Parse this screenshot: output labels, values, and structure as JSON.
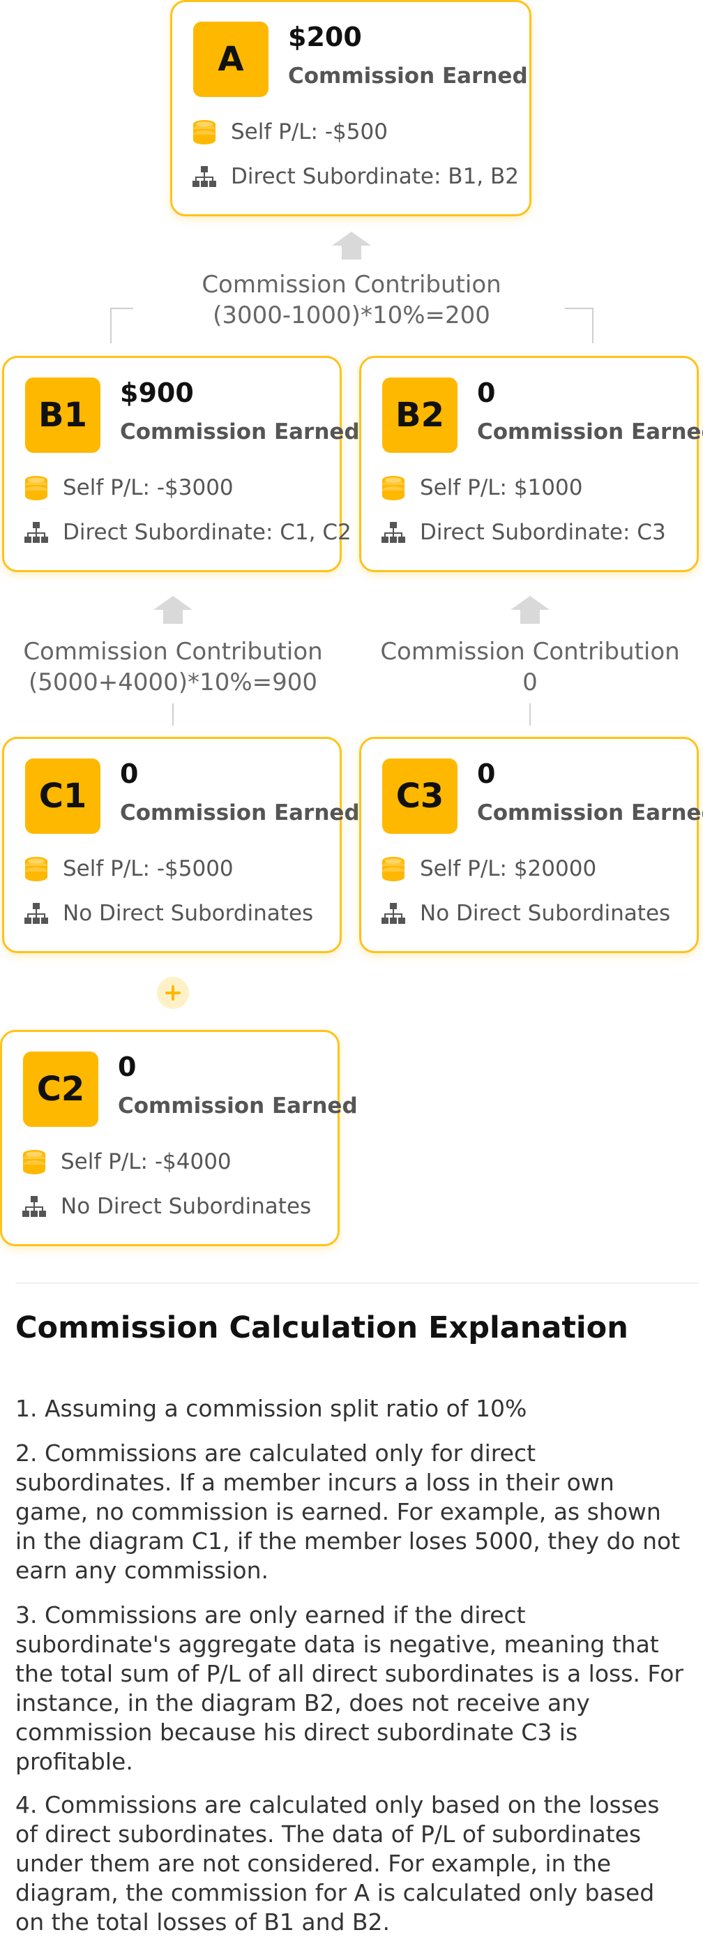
{
  "nodes": {
    "A": {
      "label": "A",
      "amount": "$200",
      "earned": "Commission Earned",
      "pl": "Self P/L: -$500",
      "subs": "Direct  Subordinate: B1, B2"
    },
    "B1": {
      "label": "B1",
      "amount": "$900",
      "earned": "Commission Earned",
      "pl": "Self P/L: -$3000",
      "subs": "Direct  Subordinate: C1, C2"
    },
    "B2": {
      "label": "B2",
      "amount": "0",
      "earned": "Commission Earned",
      "pl": "Self P/L: $1000",
      "subs": "Direct  Subordinate: C3"
    },
    "C1": {
      "label": "C1",
      "amount": "0",
      "earned": "Commission Earned",
      "pl": "Self P/L: -$5000",
      "subs": "No Direct Subordinates"
    },
    "C3": {
      "label": "C3",
      "amount": "0",
      "earned": "Commission Earned",
      "pl": "Self P/L: $20000",
      "subs": "No Direct Subordinates"
    },
    "C2": {
      "label": "C2",
      "amount": "0",
      "earned": "Commission Earned",
      "pl": "Self P/L: -$4000",
      "subs": "No Direct Subordinates"
    }
  },
  "contributions": {
    "to_A": {
      "title": "Commission   Contribution",
      "formula": "(3000-1000)*10%=200"
    },
    "to_B1": {
      "title": "Commission   Contribution",
      "formula": "(5000+4000)*10%=900"
    },
    "to_B2": {
      "title": "Commission   Contribution",
      "formula": "0"
    }
  },
  "explanation": {
    "title": "Commission Calculation Explanation",
    "points": [
      "1. Assuming a commission split ratio of 10%",
      "2. Commissions are calculated only for direct subordinates. If a member incurs a loss in their own game, no commission is earned. For example, as shown in the diagram C1, if the member loses 5000, they do not earn any commission.",
      "3. Commissions are only earned if the direct subordinate's aggregate data is negative, meaning that the total sum of P/L of all direct subordinates is a loss. For instance, in the diagram B2, does not receive any commission because his direct subordinate C3 is profitable.",
      "4. Commissions are calculated only based on the losses of direct subordinates. The data of P/L of subordinates under them are not considered. For example, in the diagram, the commission for A is calculated only based on the total losses of B1 and B2."
    ]
  },
  "colors": {
    "accent": "#FFB800",
    "border": "#FFC21A",
    "arrow": "#D9D9D9"
  },
  "icons": {
    "pl": "coin-stack-icon",
    "subs": "org-chart-icon",
    "arrow": "up-arrow-icon",
    "plus": "plus-icon"
  }
}
